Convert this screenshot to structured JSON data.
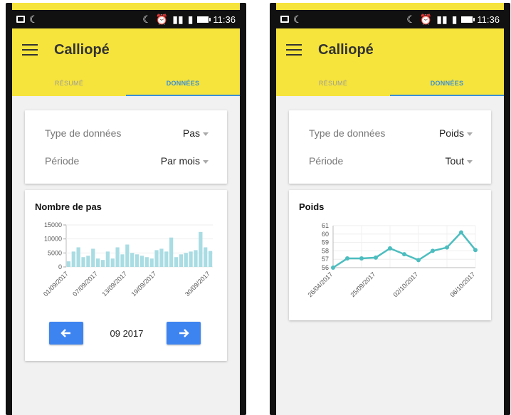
{
  "status_bar": {
    "time": "11:36"
  },
  "app": {
    "title": "Calliopé"
  },
  "tabs": [
    {
      "label": "RÉSUMÉ"
    },
    {
      "label": "DONNÉES"
    }
  ],
  "colors": {
    "appbar": "#f6e43c",
    "accent": "#3a8fd8",
    "button": "#3e84f0",
    "bar": "#a9dce3",
    "line": "#4dbdbf"
  },
  "left_screen": {
    "filter": {
      "type_label": "Type de données",
      "type_value": "Pas",
      "period_label": "Période",
      "period_value": "Par mois"
    },
    "chart_title": "Nombre de pas",
    "period_nav": {
      "label": "09 2017",
      "prev_icon": "arrow-left-icon",
      "next_icon": "arrow-right-icon"
    }
  },
  "right_screen": {
    "filter": {
      "type_label": "Type de données",
      "type_value": "Poids",
      "period_label": "Période",
      "period_value": "Tout"
    },
    "chart_title": "Poids"
  },
  "chart_data": [
    {
      "type": "bar",
      "title": "Nombre de pas",
      "ylim": [
        0,
        15000
      ],
      "yticks": [
        "0",
        "5000",
        "10000",
        "15000"
      ],
      "xticks": [
        "01/09/2017",
        "07/09/2017",
        "13/09/2017",
        "19/09/2017",
        "30/09/2017"
      ],
      "values": [
        2000,
        5500,
        7000,
        3500,
        4000,
        6500,
        3000,
        2500,
        5500,
        3000,
        7000,
        4500,
        8000,
        5000,
        4500,
        4000,
        3500,
        3000,
        6000,
        6500,
        5500,
        10500,
        3500,
        4500,
        5000,
        5500,
        6000,
        12500,
        7000,
        5700
      ]
    },
    {
      "type": "line",
      "title": "Poids",
      "ylim": [
        56,
        61
      ],
      "yticks": [
        "56",
        "57",
        "58",
        "59",
        "60",
        "61"
      ],
      "xticks": [
        "26/04/2017",
        "25/09/2017",
        "02/10/2017",
        "06/10/2017"
      ],
      "values": [
        56.0,
        57.1,
        57.1,
        57.2,
        58.3,
        57.6,
        56.9,
        58.0,
        58.4,
        60.2,
        58.1
      ]
    }
  ]
}
